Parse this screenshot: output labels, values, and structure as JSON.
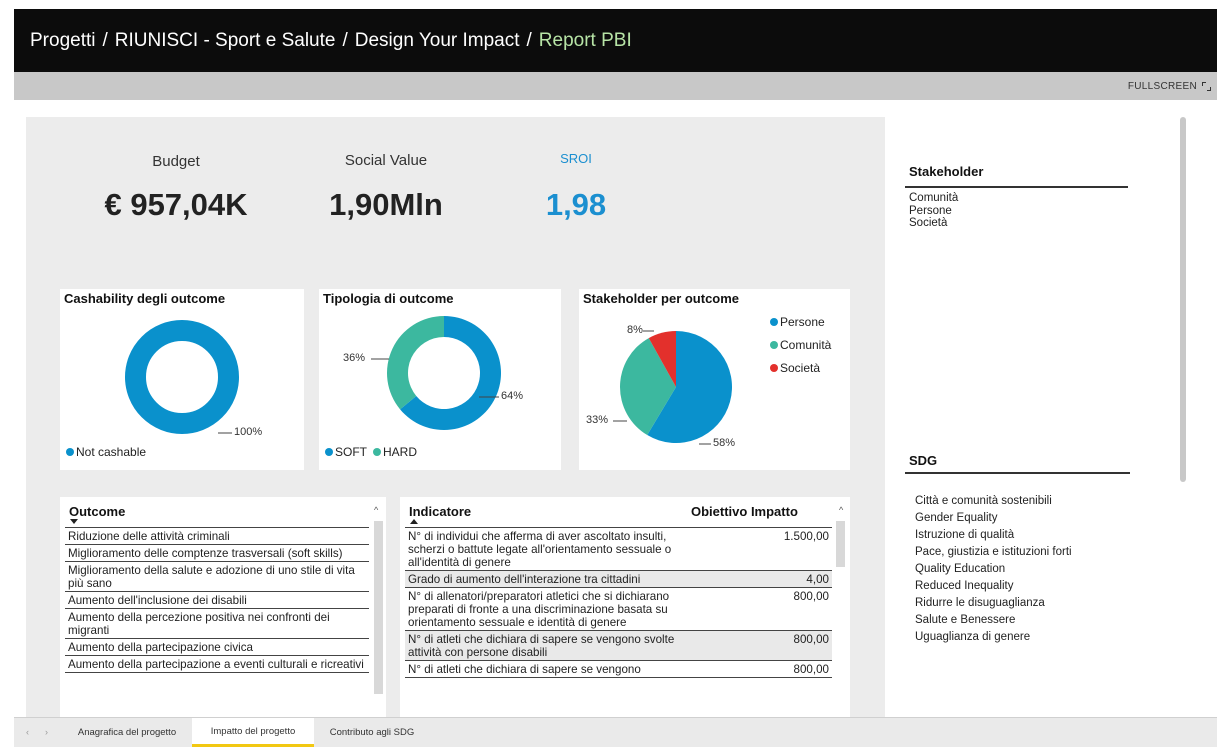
{
  "breadcrumb": {
    "items": [
      "Progetti",
      "RIUNISCI - Sport e Salute",
      "Design Your Impact"
    ],
    "current": "Report PBI",
    "separator": "/"
  },
  "toolbar": {
    "fullscreen_label": "FULLSCREEN",
    "fullscreen_icon": "fullscreen-icon"
  },
  "kpis": {
    "budget": {
      "label": "Budget",
      "value": "€ 957,04K"
    },
    "social_value": {
      "label": "Social Value",
      "value": "1,90Mln"
    },
    "sroi": {
      "label": "SROI",
      "value": "1,98",
      "color": "#1b8fd0"
    }
  },
  "colors": {
    "blue": "#0a91cc",
    "teal": "#3cb89f",
    "red": "#e3302c",
    "tab_accent": "#f2c812"
  },
  "cashability": {
    "title": "Cashability degli outcome",
    "legend": [
      "Not cashable"
    ],
    "label": "100%"
  },
  "tipologia": {
    "title": "Tipologia di outcome",
    "legend": [
      "SOFT",
      "HARD"
    ],
    "label_soft": "64%",
    "label_hard": "36%"
  },
  "stakeholder_chart": {
    "title": "Stakeholder per outcome",
    "legend": [
      "Persone",
      "Comunità",
      "Società"
    ],
    "label_persone": "58%",
    "label_comunita": "33%",
    "label_societa": "8%"
  },
  "chart_data": [
    {
      "type": "pie",
      "title": "Cashability degli outcome",
      "donut": true,
      "labels": [
        "Not cashable"
      ],
      "values": [
        100
      ]
    },
    {
      "type": "pie",
      "title": "Tipologia di outcome",
      "donut": true,
      "labels": [
        "SOFT",
        "HARD"
      ],
      "values": [
        64,
        36
      ]
    },
    {
      "type": "pie",
      "title": "Stakeholder per outcome",
      "donut": false,
      "labels": [
        "Persone",
        "Comunità",
        "Società"
      ],
      "values": [
        58,
        33,
        8
      ]
    }
  ],
  "outcome_table": {
    "header": "Outcome",
    "rows": [
      "Riduzione delle attività criminali",
      "Miglioramento delle comptenze trasversali (soft skills)",
      "Miglioramento della salute e adozione di uno stile di vita più sano",
      "Aumento dell'inclusione dei disabili",
      "Aumento della percezione positiva nei confronti dei migranti",
      "Aumento della partecipazione civica",
      "Aumento della partecipazione a eventi culturali e ricreativi"
    ]
  },
  "indicator_table": {
    "header_indicator": "Indicatore",
    "header_target": "Obiettivo Impatto",
    "rows": [
      {
        "indicatore": "N° di individui che afferma di aver ascoltato insulti, scherzi o battute legate all'orientamento sessuale o all'identità di genere",
        "obiettivo": "1.500,00"
      },
      {
        "indicatore": "Grado di aumento dell'interazione tra cittadini",
        "obiettivo": "4,00"
      },
      {
        "indicatore": "N° di allenatori/preparatori atletici che si dichiarano preparati di fronte a una discriminazione basata su orientamento sessuale e identità di genere",
        "obiettivo": "800,00"
      },
      {
        "indicatore": "N° di atleti che dichiara di sapere se vengono svolte attività con persone disabili",
        "obiettivo": "800,00"
      },
      {
        "indicatore": "N° di atleti che dichiara di sapere se vengono",
        "obiettivo": "800,00"
      }
    ]
  },
  "stakeholder_slicer": {
    "title": "Stakeholder",
    "items": [
      "Comunità",
      "Persone",
      "Società"
    ]
  },
  "sdg_slicer": {
    "title": "SDG",
    "items": [
      "Città e comunità sostenibili",
      "Gender Equality",
      "Istruzione di qualità",
      "Pace, giustizia e istituzioni forti",
      "Quality Education",
      "Reduced Inequality",
      "Ridurre le disuguaglianza",
      "Salute e Benessere",
      "Uguaglianza di genere"
    ]
  },
  "tabs": {
    "items": [
      "Anagrafica del progetto",
      "Impatto del progetto",
      "Contributo agli SDG"
    ],
    "active_index": 1
  }
}
